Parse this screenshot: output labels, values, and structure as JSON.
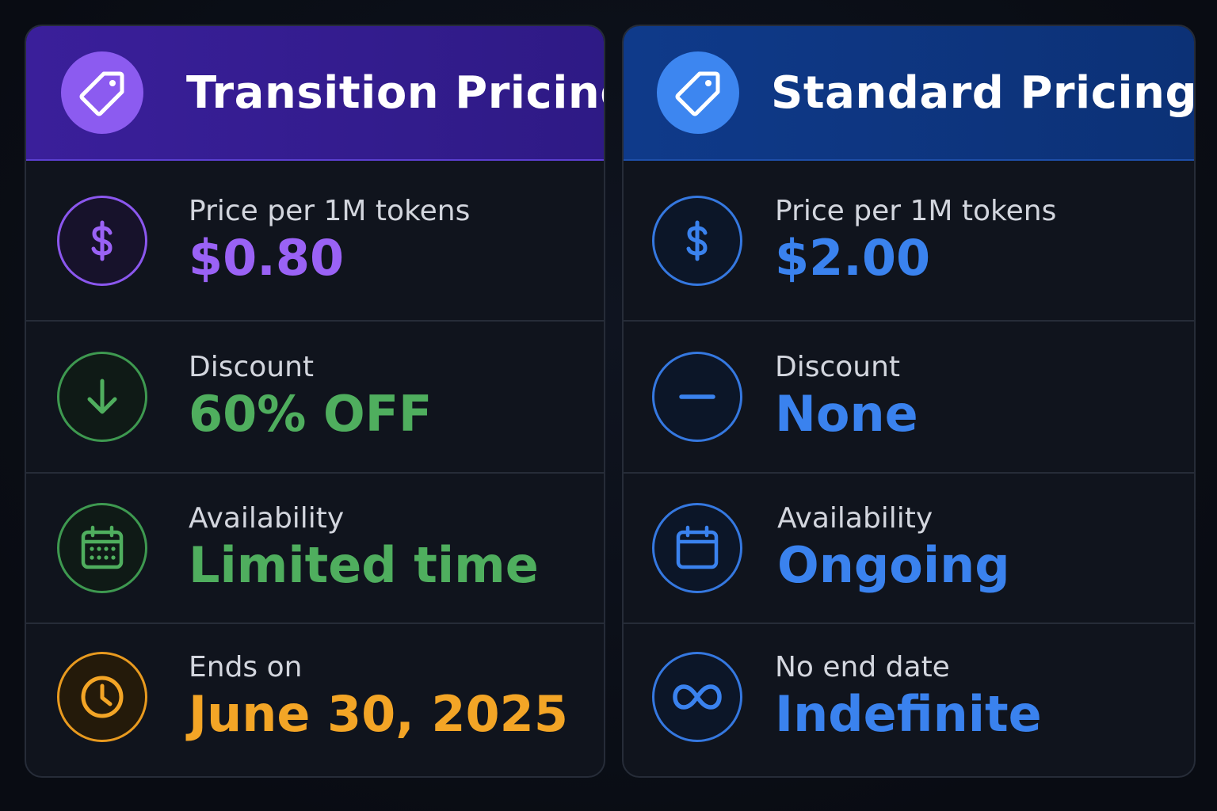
{
  "colors": {
    "purple": "#9a62f5",
    "green": "#4fae5e",
    "orange": "#f3a526",
    "blue": "#3a82ee",
    "transition_header": "#3a1f9a",
    "standard_header": "#0f3a8a"
  },
  "transition": {
    "title": "Transition Pricing",
    "header_icon": "tag-icon",
    "rows": [
      {
        "icon": "dollar-icon",
        "label": "Price per 1M tokens",
        "value": "$0.80"
      },
      {
        "icon": "arrow-down-icon",
        "label": "Discount",
        "value": "60% OFF"
      },
      {
        "icon": "calendar-icon",
        "label": "Availability",
        "value": "Limited time"
      },
      {
        "icon": "clock-icon",
        "label": "Ends on",
        "value": "June 30, 2025"
      }
    ]
  },
  "standard": {
    "title": "Standard Pricing",
    "header_icon": "tag-icon",
    "rows": [
      {
        "icon": "dollar-icon",
        "label": "Price per 1M tokens",
        "value": "$2.00"
      },
      {
        "icon": "minus-icon",
        "label": "Discount",
        "value": "None"
      },
      {
        "icon": "calendar-icon",
        "label": "Availability",
        "value": "Ongoing"
      },
      {
        "icon": "infinity-icon",
        "label": "No end date",
        "value": "Indefinite"
      }
    ]
  }
}
